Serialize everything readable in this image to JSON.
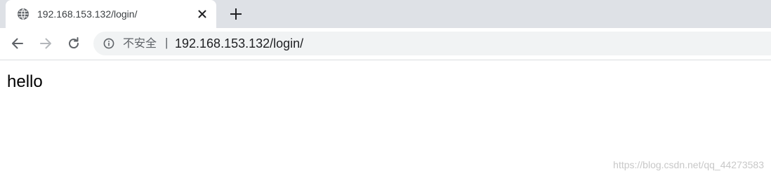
{
  "tab": {
    "title": "192.168.153.132/login/",
    "favicon": "globe-icon",
    "close_icon": "close-icon"
  },
  "new_tab_icon": "plus-icon",
  "toolbar": {
    "back_icon": "arrow-left-icon",
    "forward_icon": "arrow-right-icon",
    "reload_icon": "reload-icon"
  },
  "omnibox": {
    "info_icon": "info-icon",
    "security_label": "不安全",
    "divider": "|",
    "url": "192.168.153.132/login/"
  },
  "page": {
    "body_text": "hello"
  },
  "watermark": "https://blog.csdn.net/qq_44273583",
  "colors": {
    "tab_strip_bg": "#dee1e6",
    "omnibox_bg": "#f1f3f4",
    "icon_color": "#5f6368",
    "forward_disabled": "#b4b7bb"
  }
}
